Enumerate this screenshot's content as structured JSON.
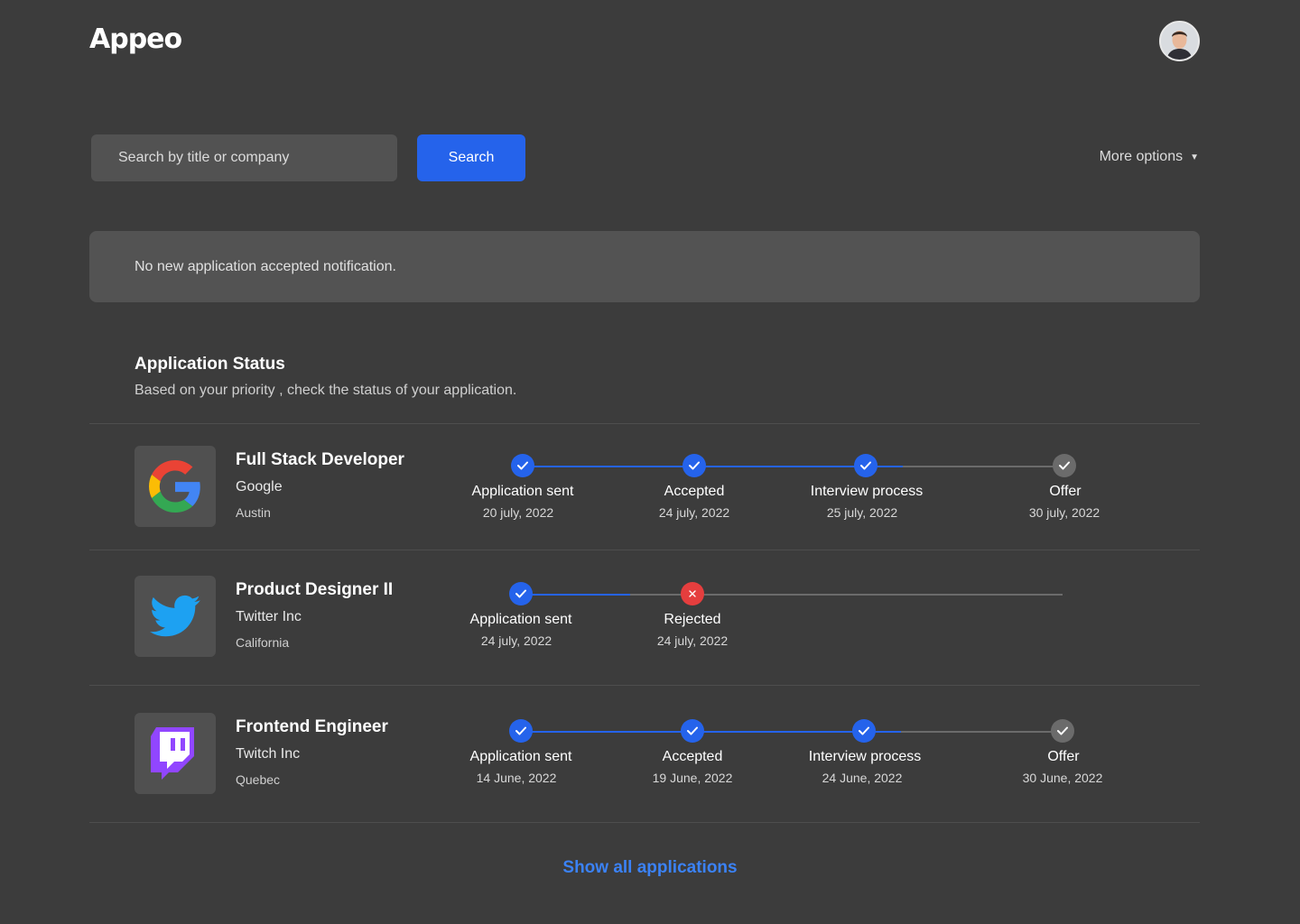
{
  "brand": {
    "name": "Appeo"
  },
  "header": {
    "avatar_icon": "user-avatar"
  },
  "search": {
    "placeholder": "Search by title or company",
    "button_label": "Search",
    "more_options_label": "More options"
  },
  "notice": {
    "text": "No new application accepted notification."
  },
  "section": {
    "title": "Application Status",
    "subtitle": "Based on your priority , check the status of your application."
  },
  "colors": {
    "accent": "#2563eb",
    "rejected": "#e53e3e",
    "pending": "#6b6b6b"
  },
  "applications": [
    {
      "title": "Full Stack Developer",
      "company": "Google",
      "city": "Austin",
      "logo_icon": "google-logo",
      "steps": [
        {
          "label": "Application sent",
          "date": "20 july, 2022",
          "state": "done"
        },
        {
          "label": "Accepted",
          "date": "24 july, 2022",
          "state": "done"
        },
        {
          "label": "Interview process",
          "date": "25 july, 2022",
          "state": "done"
        },
        {
          "label": "Offer",
          "date": "30 july, 2022",
          "state": "pending"
        }
      ]
    },
    {
      "title": "Product Designer II",
      "company": "Twitter Inc",
      "city": "California",
      "logo_icon": "twitter-logo",
      "steps": [
        {
          "label": "Application sent",
          "date": "24 july, 2022",
          "state": "done"
        },
        {
          "label": "Rejected",
          "date": "24 july, 2022",
          "state": "rejected"
        }
      ]
    },
    {
      "title": "Frontend Engineer",
      "company": "Twitch Inc",
      "city": "Quebec",
      "logo_icon": "twitch-logo",
      "steps": [
        {
          "label": "Application sent",
          "date": "14 June, 2022",
          "state": "done"
        },
        {
          "label": "Accepted",
          "date": "19 June, 2022",
          "state": "done"
        },
        {
          "label": "Interview process",
          "date": "24 June, 2022",
          "state": "done"
        },
        {
          "label": "Offer",
          "date": "30 June, 2022",
          "state": "pending"
        }
      ]
    }
  ],
  "footer": {
    "show_all_label": "Show all applications"
  }
}
